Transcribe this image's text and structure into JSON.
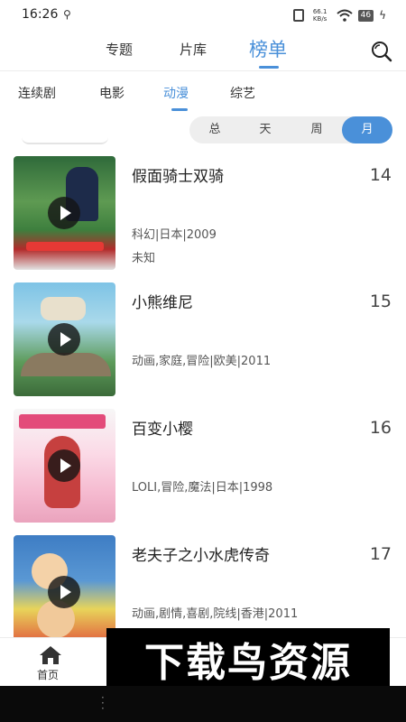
{
  "status_bar": {
    "time": "16:26",
    "net_speed": "66.1 KB/s",
    "signal": "46"
  },
  "top_nav": {
    "tabs": [
      "专题",
      "片库",
      "榜单"
    ],
    "active_index": 2
  },
  "category_tabs": {
    "items": [
      "连续剧",
      "电影",
      "动漫",
      "综艺"
    ],
    "active_index": 2
  },
  "period_filter": {
    "items": [
      "总",
      "天",
      "周",
      "月"
    ],
    "active_index": 3
  },
  "ranking_list": [
    {
      "title": "假面骑士双骑",
      "rank": "14",
      "meta": "科幻|日本|2009",
      "extra": "未知"
    },
    {
      "title": "小熊维尼",
      "rank": "15",
      "meta": "动画,家庭,冒险|欧美|2011",
      "extra": ""
    },
    {
      "title": "百变小樱",
      "rank": "16",
      "meta": "LOLI,冒险,魔法|日本|1998",
      "extra": ""
    },
    {
      "title": "老夫子之小水虎传奇",
      "rank": "17",
      "meta": "动画,剧情,喜剧,院线|香港|2011",
      "extra": ""
    }
  ],
  "bottom_nav": {
    "home_label": "首页"
  },
  "watermark": {
    "text": "下载鸟资源"
  },
  "colors": {
    "accent": "#4a90d9"
  },
  "icons": {
    "search": "search-icon",
    "home": "home-icon",
    "play": "play-icon"
  }
}
